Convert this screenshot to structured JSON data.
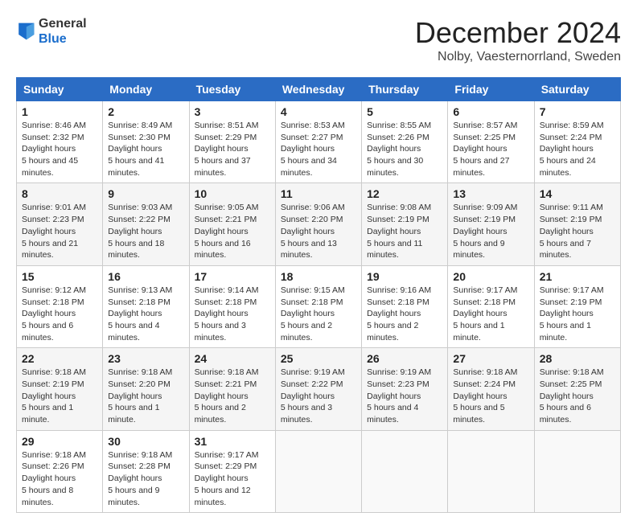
{
  "logo": {
    "general": "General",
    "blue": "Blue"
  },
  "title": "December 2024",
  "location": "Nolby, Vaesternorrland, Sweden",
  "days_of_week": [
    "Sunday",
    "Monday",
    "Tuesday",
    "Wednesday",
    "Thursday",
    "Friday",
    "Saturday"
  ],
  "weeks": [
    [
      {
        "day": "1",
        "sunrise": "8:46 AM",
        "sunset": "2:32 PM",
        "daylight": "5 hours and 45 minutes."
      },
      {
        "day": "2",
        "sunrise": "8:49 AM",
        "sunset": "2:30 PM",
        "daylight": "5 hours and 41 minutes."
      },
      {
        "day": "3",
        "sunrise": "8:51 AM",
        "sunset": "2:29 PM",
        "daylight": "5 hours and 37 minutes."
      },
      {
        "day": "4",
        "sunrise": "8:53 AM",
        "sunset": "2:27 PM",
        "daylight": "5 hours and 34 minutes."
      },
      {
        "day": "5",
        "sunrise": "8:55 AM",
        "sunset": "2:26 PM",
        "daylight": "5 hours and 30 minutes."
      },
      {
        "day": "6",
        "sunrise": "8:57 AM",
        "sunset": "2:25 PM",
        "daylight": "5 hours and 27 minutes."
      },
      {
        "day": "7",
        "sunrise": "8:59 AM",
        "sunset": "2:24 PM",
        "daylight": "5 hours and 24 minutes."
      }
    ],
    [
      {
        "day": "8",
        "sunrise": "9:01 AM",
        "sunset": "2:23 PM",
        "daylight": "5 hours and 21 minutes."
      },
      {
        "day": "9",
        "sunrise": "9:03 AM",
        "sunset": "2:22 PM",
        "daylight": "5 hours and 18 minutes."
      },
      {
        "day": "10",
        "sunrise": "9:05 AM",
        "sunset": "2:21 PM",
        "daylight": "5 hours and 16 minutes."
      },
      {
        "day": "11",
        "sunrise": "9:06 AM",
        "sunset": "2:20 PM",
        "daylight": "5 hours and 13 minutes."
      },
      {
        "day": "12",
        "sunrise": "9:08 AM",
        "sunset": "2:19 PM",
        "daylight": "5 hours and 11 minutes."
      },
      {
        "day": "13",
        "sunrise": "9:09 AM",
        "sunset": "2:19 PM",
        "daylight": "5 hours and 9 minutes."
      },
      {
        "day": "14",
        "sunrise": "9:11 AM",
        "sunset": "2:19 PM",
        "daylight": "5 hours and 7 minutes."
      }
    ],
    [
      {
        "day": "15",
        "sunrise": "9:12 AM",
        "sunset": "2:18 PM",
        "daylight": "5 hours and 6 minutes."
      },
      {
        "day": "16",
        "sunrise": "9:13 AM",
        "sunset": "2:18 PM",
        "daylight": "5 hours and 4 minutes."
      },
      {
        "day": "17",
        "sunrise": "9:14 AM",
        "sunset": "2:18 PM",
        "daylight": "5 hours and 3 minutes."
      },
      {
        "day": "18",
        "sunrise": "9:15 AM",
        "sunset": "2:18 PM",
        "daylight": "5 hours and 2 minutes."
      },
      {
        "day": "19",
        "sunrise": "9:16 AM",
        "sunset": "2:18 PM",
        "daylight": "5 hours and 2 minutes."
      },
      {
        "day": "20",
        "sunrise": "9:17 AM",
        "sunset": "2:18 PM",
        "daylight": "5 hours and 1 minute."
      },
      {
        "day": "21",
        "sunrise": "9:17 AM",
        "sunset": "2:19 PM",
        "daylight": "5 hours and 1 minute."
      }
    ],
    [
      {
        "day": "22",
        "sunrise": "9:18 AM",
        "sunset": "2:19 PM",
        "daylight": "5 hours and 1 minute."
      },
      {
        "day": "23",
        "sunrise": "9:18 AM",
        "sunset": "2:20 PM",
        "daylight": "5 hours and 1 minute."
      },
      {
        "day": "24",
        "sunrise": "9:18 AM",
        "sunset": "2:21 PM",
        "daylight": "5 hours and 2 minutes."
      },
      {
        "day": "25",
        "sunrise": "9:19 AM",
        "sunset": "2:22 PM",
        "daylight": "5 hours and 3 minutes."
      },
      {
        "day": "26",
        "sunrise": "9:19 AM",
        "sunset": "2:23 PM",
        "daylight": "5 hours and 4 minutes."
      },
      {
        "day": "27",
        "sunrise": "9:18 AM",
        "sunset": "2:24 PM",
        "daylight": "5 hours and 5 minutes."
      },
      {
        "day": "28",
        "sunrise": "9:18 AM",
        "sunset": "2:25 PM",
        "daylight": "5 hours and 6 minutes."
      }
    ],
    [
      {
        "day": "29",
        "sunrise": "9:18 AM",
        "sunset": "2:26 PM",
        "daylight": "5 hours and 8 minutes."
      },
      {
        "day": "30",
        "sunrise": "9:18 AM",
        "sunset": "2:28 PM",
        "daylight": "5 hours and 9 minutes."
      },
      {
        "day": "31",
        "sunrise": "9:17 AM",
        "sunset": "2:29 PM",
        "daylight": "5 hours and 12 minutes."
      },
      null,
      null,
      null,
      null
    ]
  ],
  "labels": {
    "sunrise": "Sunrise:",
    "sunset": "Sunset:",
    "daylight": "Daylight:"
  }
}
